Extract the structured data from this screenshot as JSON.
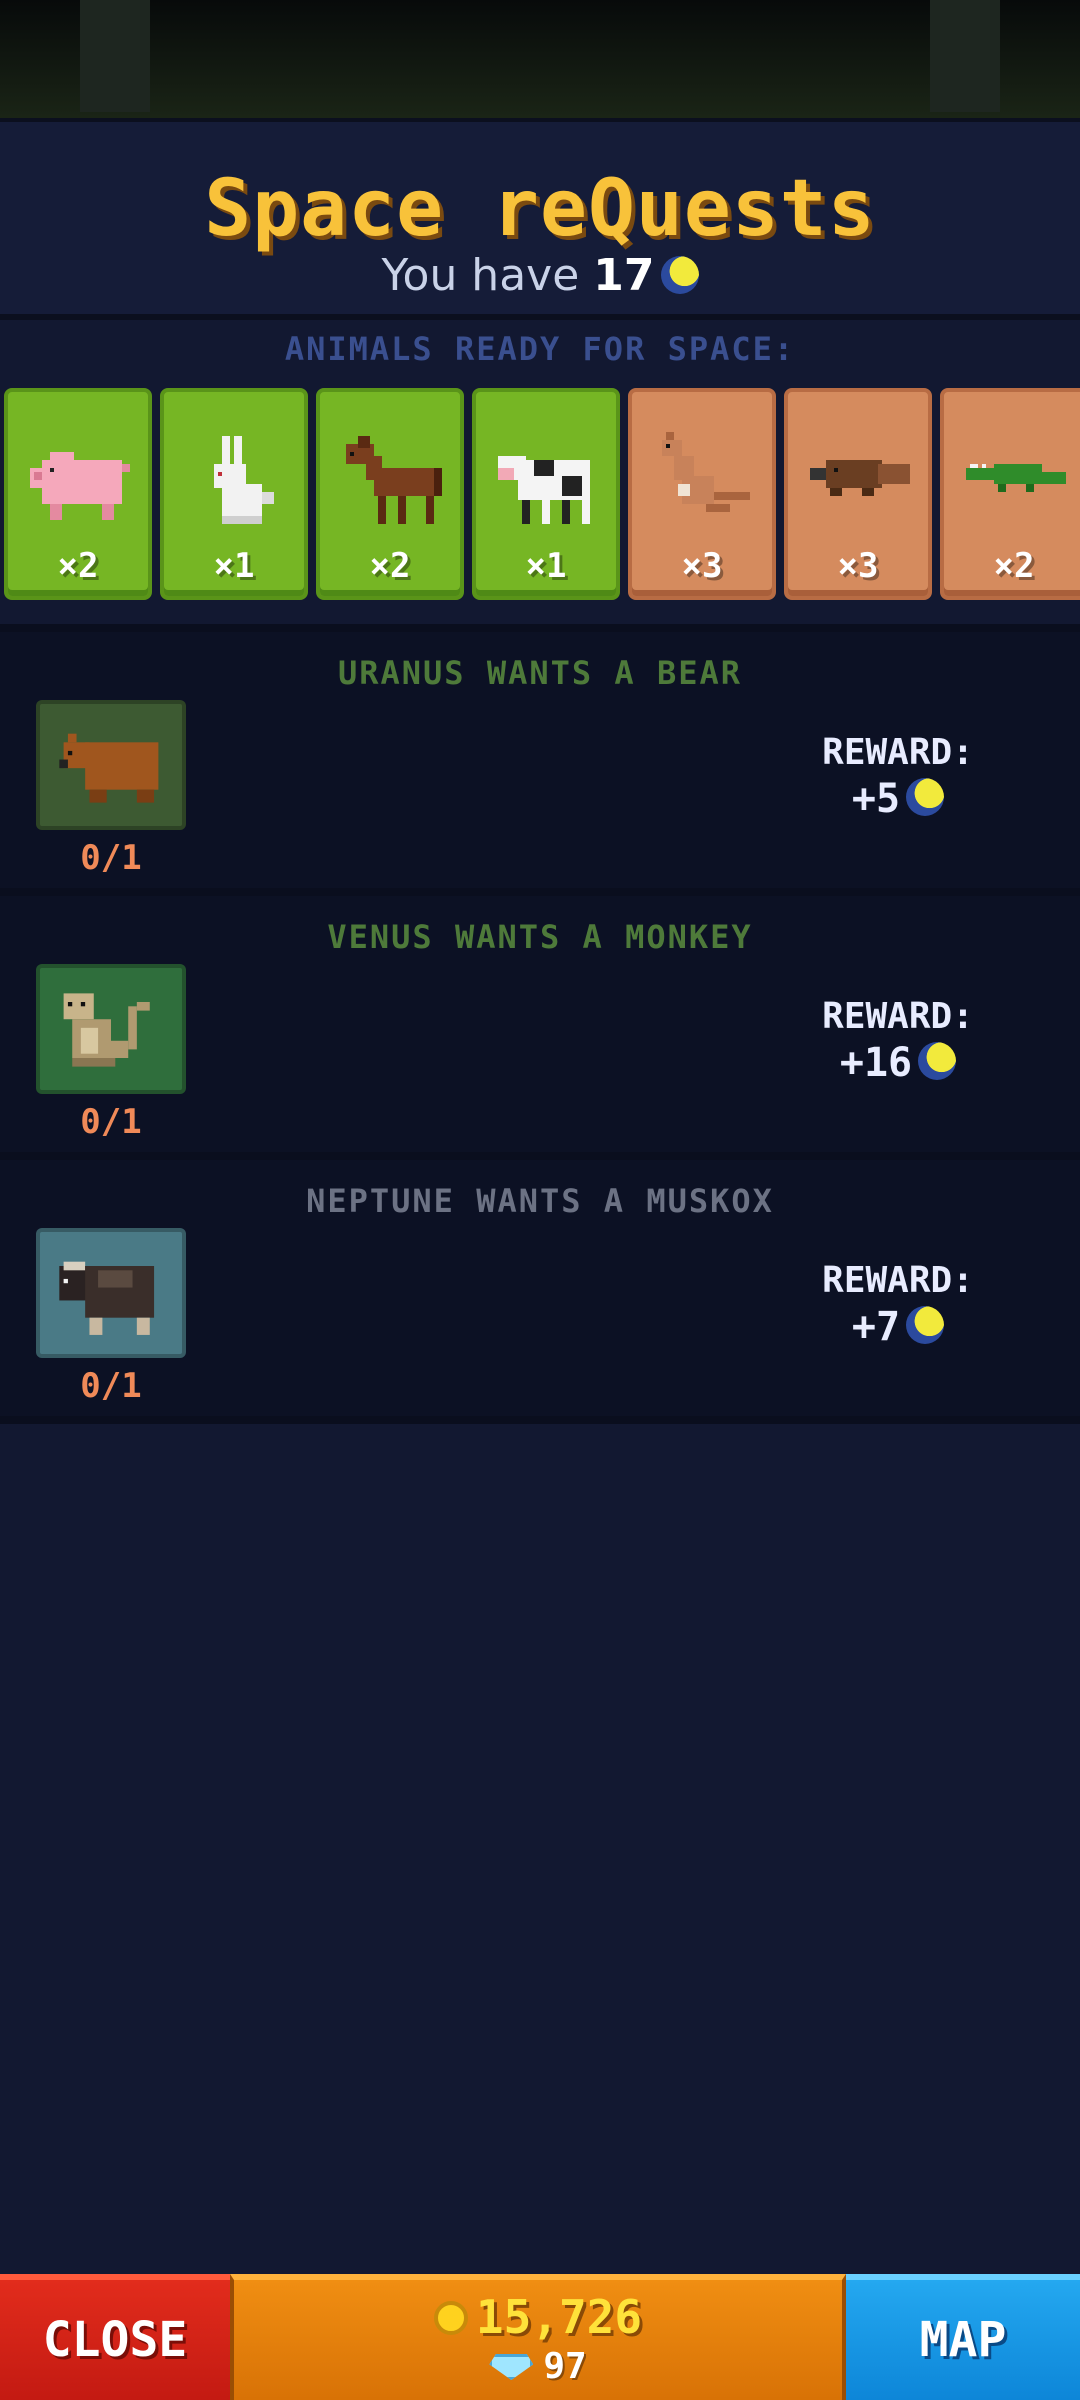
{
  "header": {
    "title": "Space reQuests",
    "subtitle_prefix": "You have",
    "moon_count": "17",
    "moon_icon": "moon-token-icon"
  },
  "ready_section": {
    "label": "ANIMALS READY FOR SPACE:",
    "cards": [
      {
        "animal": "pig-icon",
        "qty": "×2",
        "terrain": "grass"
      },
      {
        "animal": "rabbit-icon",
        "qty": "×1",
        "terrain": "grass"
      },
      {
        "animal": "horse-icon",
        "qty": "×2",
        "terrain": "grass"
      },
      {
        "animal": "cow-icon",
        "qty": "×1",
        "terrain": "grass"
      },
      {
        "animal": "kangaroo-icon",
        "qty": "×3",
        "terrain": "desert"
      },
      {
        "animal": "platypus-icon",
        "qty": "×3",
        "terrain": "desert"
      },
      {
        "animal": "crocodile-icon",
        "qty": "×2",
        "terrain": "desert"
      }
    ]
  },
  "requests": [
    {
      "title": "URANUS WANTS A BEAR",
      "title_color": "#4e7a3a",
      "animal": "bear-icon",
      "icon_bg": "#3d5a32",
      "progress": "0/1",
      "reward_label": "REWARD:",
      "reward": "+5"
    },
    {
      "title": "VENUS WANTS A MONKEY",
      "title_color": "#4e7a3a",
      "animal": "monkey-icon",
      "icon_bg": "#2f6e3c",
      "progress": "0/1",
      "reward_label": "REWARD:",
      "reward": "+16"
    },
    {
      "title": "NEPTUNE WANTS A MUSKOX",
      "title_color": "#6c7284",
      "animal": "muskox-icon",
      "icon_bg": "#4a7a86",
      "progress": "0/1",
      "reward_label": "REWARD:",
      "reward": "+7"
    }
  ],
  "bottom_bar": {
    "close_label": "CLOSE",
    "coins": "15,726",
    "gems": "97",
    "map_label": "MAP"
  }
}
